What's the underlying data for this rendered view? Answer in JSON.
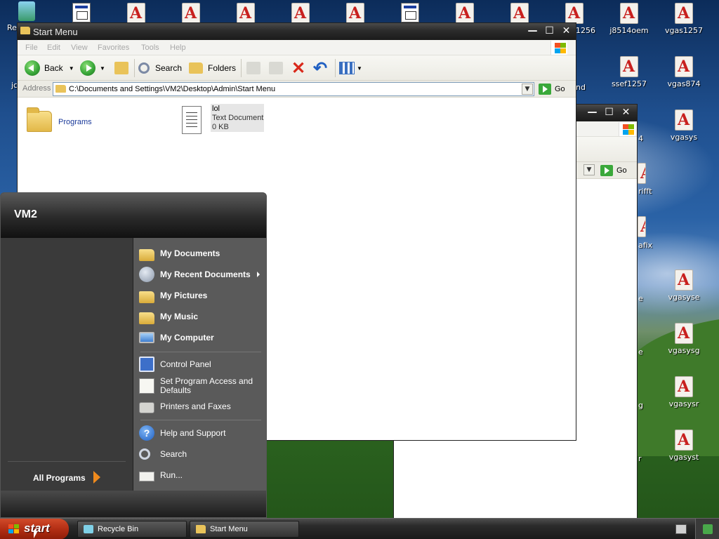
{
  "desktop": {
    "icons": [
      {
        "label": "Re",
        "type": "recycle"
      },
      {
        "label": "",
        "type": "exe"
      },
      {
        "label": "",
        "type": "pdf"
      },
      {
        "label": "",
        "type": "pdf"
      },
      {
        "label": "",
        "type": "pdf"
      },
      {
        "label": "",
        "type": "pdf"
      },
      {
        "label": "",
        "type": "pdf"
      },
      {
        "label": "",
        "type": "exe"
      },
      {
        "label": "",
        "type": "pdf"
      },
      {
        "label": "",
        "type": "pdf"
      },
      {
        "label": "1256",
        "type": "pdf"
      },
      {
        "label": "j8514oem",
        "type": "pdf"
      },
      {
        "label": "vgas1257",
        "type": "pdf"
      },
      {
        "label": "jc",
        "type": "pdf"
      },
      {
        "label": "nd",
        "type": "pdf"
      },
      {
        "label": "ssef1257",
        "type": "pdf"
      },
      {
        "label": "vgas874",
        "type": "pdf"
      },
      {
        "label": "4",
        "type": "pdf"
      },
      {
        "label": "vgasys",
        "type": "pdf"
      },
      {
        "label": "rifft",
        "type": "pdf"
      },
      {
        "label": "afix",
        "type": "pdf"
      },
      {
        "label": "e",
        "type": "pdf"
      },
      {
        "label": "vgasyse",
        "type": "pdf"
      },
      {
        "label": "e",
        "type": "pdf"
      },
      {
        "label": "vgasysg",
        "type": "pdf"
      },
      {
        "label": "g",
        "type": "pdf"
      },
      {
        "label": "vgasysr",
        "type": "pdf"
      },
      {
        "label": "r",
        "type": "pdf"
      },
      {
        "label": "vgasyst",
        "type": "pdf"
      }
    ]
  },
  "explorer": {
    "title": "Start Menu",
    "menu": [
      "File",
      "Edit",
      "View",
      "Favorites",
      "Tools",
      "Help"
    ],
    "toolbar": {
      "back": "Back",
      "search": "Search",
      "folders": "Folders"
    },
    "address": {
      "label": "Address",
      "value": "C:\\Documents and Settings\\VM2\\Desktop\\Admin\\Start Menu",
      "go": "Go"
    },
    "items": [
      {
        "name": "Programs",
        "kind": "folder"
      },
      {
        "name": "lol",
        "type": "Text Document",
        "size": "0 KB",
        "kind": "text"
      }
    ]
  },
  "back_window": {
    "go": "Go"
  },
  "start_menu": {
    "user": "VM2",
    "right_items": [
      {
        "label": "My Documents",
        "icon": "folder-docs-icon",
        "bold": true
      },
      {
        "label": "My Recent Documents",
        "icon": "recent-docs-icon",
        "bold": true,
        "submenu": true
      },
      {
        "label": "My Pictures",
        "icon": "folder-pictures-icon",
        "bold": true
      },
      {
        "label": "My Music",
        "icon": "folder-music-icon",
        "bold": true
      },
      {
        "label": "My Computer",
        "icon": "computer-icon",
        "bold": true
      },
      {
        "label": "Control Panel",
        "icon": "control-panel-icon",
        "bold": false
      },
      {
        "label": "Set Program Access and",
        "label2": "Defaults",
        "icon": "program-access-icon",
        "bold": false
      },
      {
        "label": "Printers and Faxes",
        "icon": "printer-icon",
        "bold": false
      },
      {
        "label": "Help and Support",
        "icon": "help-icon",
        "bold": false
      },
      {
        "label": "Search",
        "icon": "search-icon",
        "bold": false
      },
      {
        "label": "Run...",
        "icon": "run-icon",
        "bold": false
      }
    ],
    "all_programs": "All Programs"
  },
  "taskbar": {
    "start": "start",
    "tasks": [
      "Recycle Bin",
      "Start Menu"
    ]
  }
}
